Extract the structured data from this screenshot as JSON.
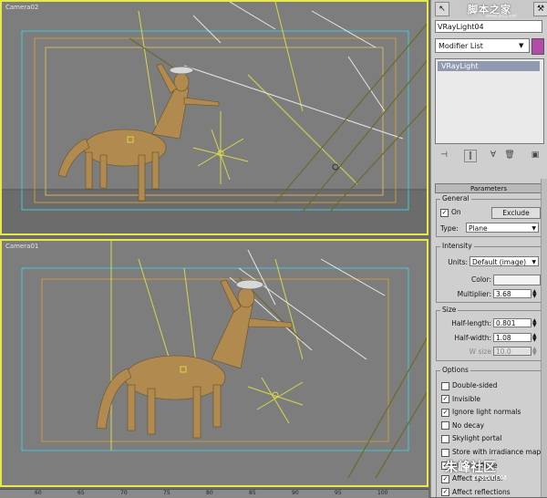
{
  "viewports": {
    "top_label": "Camera02",
    "bottom_label": "Camera01"
  },
  "ruler_ticks": [
    "60",
    "65",
    "70",
    "75",
    "80",
    "85",
    "90",
    "95",
    "100"
  ],
  "panel": {
    "logo": "脚本之家",
    "logo_url": "www.jb51.net",
    "object_name": "VRayLight04",
    "modifier_list": "Modifier List",
    "stack_item": "VRayLight",
    "rollout_title": "Parameters",
    "general": {
      "title": "General",
      "on_label": "On",
      "on_checked": true,
      "exclude_button": "Exclude",
      "type_label": "Type:",
      "type_value": "Plane"
    },
    "intensity": {
      "title": "Intensity",
      "units_label": "Units:",
      "units_value": "Default (image)",
      "color_label": "Color:",
      "multiplier_label": "Multiplier:",
      "multiplier_value": "3.68"
    },
    "size": {
      "title": "Size",
      "half_length_label": "Half-length:",
      "half_length_value": "0.801",
      "half_width_label": "Half-width:",
      "half_width_value": "1.08",
      "w_size_label": "W size",
      "w_size_value": "10.0"
    },
    "options": {
      "title": "Options",
      "items": [
        {
          "label": "Double-sided",
          "checked": false
        },
        {
          "label": "Invisible",
          "checked": true
        },
        {
          "label": "Ignore light normals",
          "checked": true
        },
        {
          "label": "No decay",
          "checked": false
        },
        {
          "label": "Skylight portal",
          "checked": false
        },
        {
          "label": "Store with irradiance map",
          "checked": false
        },
        {
          "label": "Affect diffuse",
          "checked": true
        },
        {
          "label": "Affect specular",
          "checked": true
        },
        {
          "label": "Affect reflections",
          "checked": true
        }
      ]
    }
  },
  "watermark": {
    "text": "朱峰社区",
    "url": "ZF3D.COM"
  },
  "colors": {
    "viewport_border": "#e8e84a",
    "centaur": "#b08a4e",
    "safe_frame": "#44c8d8",
    "light_lines": "#d8d84a"
  }
}
